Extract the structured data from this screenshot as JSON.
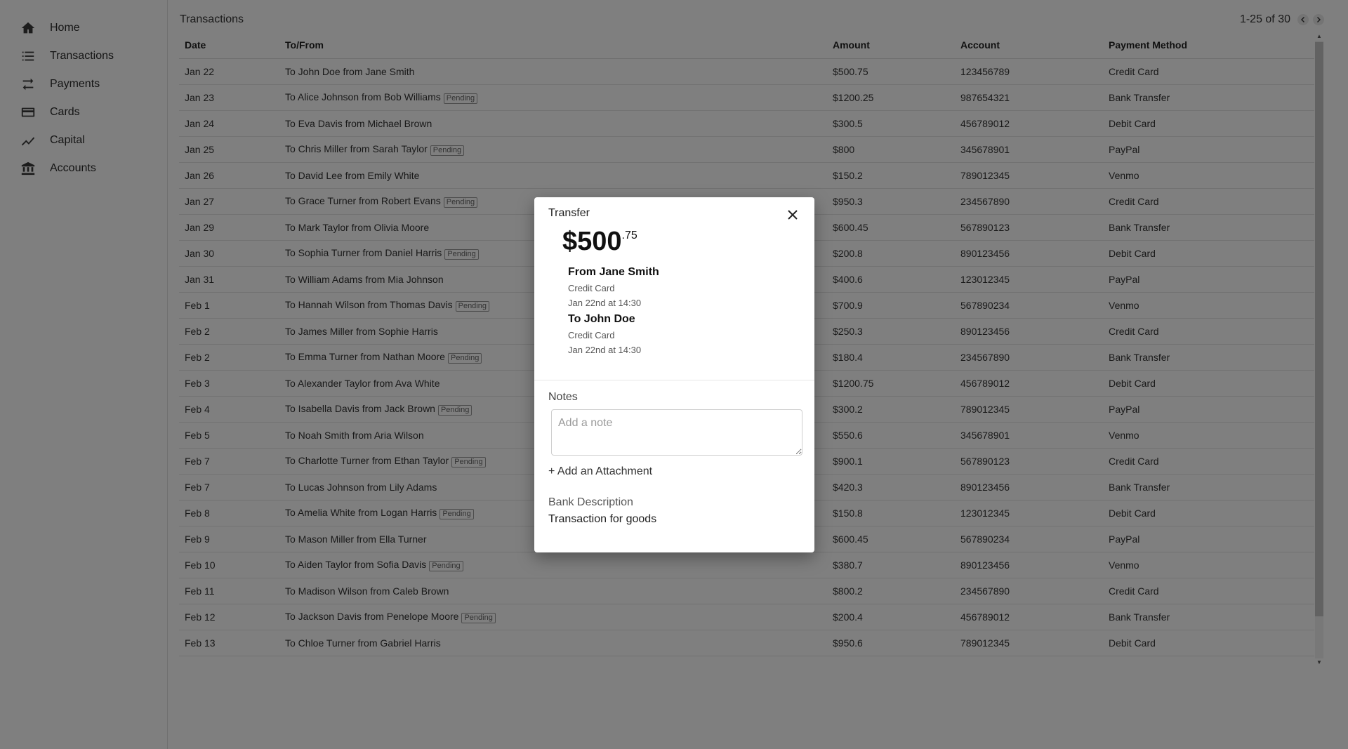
{
  "sidebar": {
    "items": [
      {
        "label": "Home",
        "icon": "home-icon"
      },
      {
        "label": "Transactions",
        "icon": "list-icon"
      },
      {
        "label": "Payments",
        "icon": "swap-icon"
      },
      {
        "label": "Cards",
        "icon": "card-icon"
      },
      {
        "label": "Capital",
        "icon": "trend-icon"
      },
      {
        "label": "Accounts",
        "icon": "bank-icon"
      }
    ]
  },
  "main": {
    "title": "Transactions",
    "pagination": "1-25 of 30",
    "columns": [
      "Date",
      "To/From",
      "Amount",
      "Account",
      "Payment Method"
    ],
    "pending_label": "Pending",
    "rows": [
      {
        "date": "Jan 22",
        "party": "To John Doe from Jane Smith",
        "pending": false,
        "amount": "$500.75",
        "account": "123456789",
        "method": "Credit Card"
      },
      {
        "date": "Jan 23",
        "party": "To Alice Johnson from Bob Williams",
        "pending": true,
        "amount": "$1200.25",
        "account": "987654321",
        "method": "Bank Transfer"
      },
      {
        "date": "Jan 24",
        "party": "To Eva Davis from Michael Brown",
        "pending": false,
        "amount": "$300.5",
        "account": "456789012",
        "method": "Debit Card"
      },
      {
        "date": "Jan 25",
        "party": "To Chris Miller from Sarah Taylor",
        "pending": true,
        "amount": "$800",
        "account": "345678901",
        "method": "PayPal"
      },
      {
        "date": "Jan 26",
        "party": "To David Lee from Emily White",
        "pending": false,
        "amount": "$150.2",
        "account": "789012345",
        "method": "Venmo"
      },
      {
        "date": "Jan 27",
        "party": "To Grace Turner from Robert Evans",
        "pending": true,
        "amount": "$950.3",
        "account": "234567890",
        "method": "Credit Card"
      },
      {
        "date": "Jan 29",
        "party": "To Mark Taylor from Olivia Moore",
        "pending": false,
        "amount": "$600.45",
        "account": "567890123",
        "method": "Bank Transfer"
      },
      {
        "date": "Jan 30",
        "party": "To Sophia Turner from Daniel Harris",
        "pending": true,
        "amount": "$200.8",
        "account": "890123456",
        "method": "Debit Card"
      },
      {
        "date": "Jan 31",
        "party": "To William Adams from Mia Johnson",
        "pending": false,
        "amount": "$400.6",
        "account": "123012345",
        "method": "PayPal"
      },
      {
        "date": "Feb 1",
        "party": "To Hannah Wilson from Thomas Davis",
        "pending": true,
        "amount": "$700.9",
        "account": "567890234",
        "method": "Venmo"
      },
      {
        "date": "Feb 2",
        "party": "To James Miller from Sophie Harris",
        "pending": false,
        "amount": "$250.3",
        "account": "890123456",
        "method": "Credit Card"
      },
      {
        "date": "Feb 2",
        "party": "To Emma Turner from Nathan Moore",
        "pending": true,
        "amount": "$180.4",
        "account": "234567890",
        "method": "Bank Transfer"
      },
      {
        "date": "Feb 3",
        "party": "To Alexander Taylor from Ava White",
        "pending": false,
        "amount": "$1200.75",
        "account": "456789012",
        "method": "Debit Card"
      },
      {
        "date": "Feb 4",
        "party": "To Isabella Davis from Jack Brown",
        "pending": true,
        "amount": "$300.2",
        "account": "789012345",
        "method": "PayPal"
      },
      {
        "date": "Feb 5",
        "party": "To Noah Smith from Aria Wilson",
        "pending": false,
        "amount": "$550.6",
        "account": "345678901",
        "method": "Venmo"
      },
      {
        "date": "Feb 7",
        "party": "To Charlotte Turner from Ethan Taylor",
        "pending": true,
        "amount": "$900.1",
        "account": "567890123",
        "method": "Credit Card"
      },
      {
        "date": "Feb 7",
        "party": "To Lucas Johnson from Lily Adams",
        "pending": false,
        "amount": "$420.3",
        "account": "890123456",
        "method": "Bank Transfer"
      },
      {
        "date": "Feb 8",
        "party": "To Amelia White from Logan Harris",
        "pending": true,
        "amount": "$150.8",
        "account": "123012345",
        "method": "Debit Card"
      },
      {
        "date": "Feb 9",
        "party": "To Mason Miller from Ella Turner",
        "pending": false,
        "amount": "$600.45",
        "account": "567890234",
        "method": "PayPal"
      },
      {
        "date": "Feb 10",
        "party": "To Aiden Taylor from Sofia Davis",
        "pending": true,
        "amount": "$380.7",
        "account": "890123456",
        "method": "Venmo"
      },
      {
        "date": "Feb 11",
        "party": "To Madison Wilson from Caleb Brown",
        "pending": false,
        "amount": "$800.2",
        "account": "234567890",
        "method": "Credit Card"
      },
      {
        "date": "Feb 12",
        "party": "To Jackson Davis from Penelope Moore",
        "pending": true,
        "amount": "$200.4",
        "account": "456789012",
        "method": "Bank Transfer"
      },
      {
        "date": "Feb 13",
        "party": "To Chloe Turner from Gabriel Harris",
        "pending": false,
        "amount": "$950.6",
        "account": "789012345",
        "method": "Debit Card"
      }
    ]
  },
  "modal": {
    "title": "Transfer",
    "amount_whole": "$500",
    "amount_cents": ".75",
    "from": {
      "name": "From Jane Smith",
      "method": "Credit Card",
      "time": "Jan 22nd at 14:30"
    },
    "to": {
      "name": "To John Doe",
      "method": "Credit Card",
      "time": "Jan 22nd at 14:30"
    },
    "notes_label": "Notes",
    "notes_placeholder": "Add a note",
    "attachment_label": "+ Add an Attachment",
    "bank_description_label": "Bank Description",
    "bank_description": "Transaction for goods"
  },
  "colors": {
    "overlay": "#000000",
    "pending_border": "#999999"
  }
}
